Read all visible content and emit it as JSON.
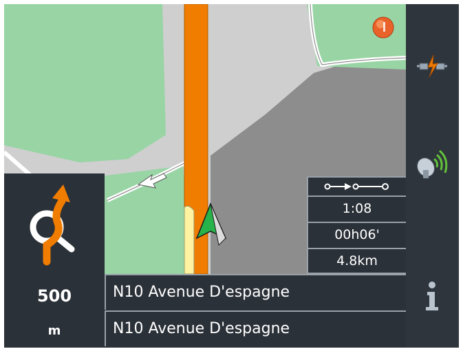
{
  "maneuver": {
    "icon": "roundabout-exit-icon",
    "distance_value": "500",
    "distance_unit": "m"
  },
  "streets": {
    "current": "N10 Avenue D'espagne",
    "next": "N10 Avenue D'espagne"
  },
  "trip": {
    "route_icon": "route-progress-icon",
    "time_of_arrival": "1:08",
    "time_remaining": "00h06'",
    "distance_remaining": "4.8km"
  },
  "sidebar": {
    "items": [
      {
        "icon": "gps-connection-icon"
      },
      {
        "icon": "satellite-signal-icon"
      },
      {
        "icon": "info-icon",
        "label": "i"
      }
    ]
  },
  "map": {
    "colors": {
      "park": "#98d4a4",
      "land": "#cfcfcf",
      "urban": "#8a8a8a",
      "route": "#f07c00",
      "vehicle": "#27b34a"
    }
  }
}
